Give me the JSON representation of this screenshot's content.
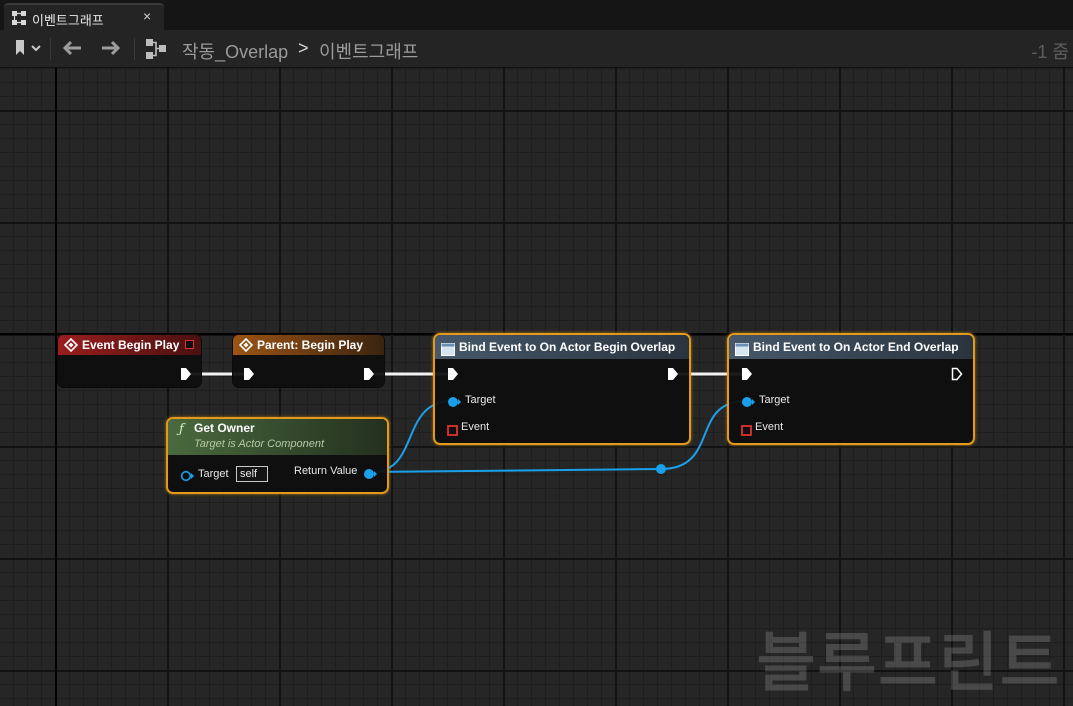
{
  "tab": {
    "title": "이벤트그래프",
    "close": "×"
  },
  "toolbar": {
    "breadcrumb_root": "작동_Overlap",
    "breadcrumb_sep": ">",
    "breadcrumb_current": "이벤트그래프",
    "zoom": "-1 줌"
  },
  "nodes": {
    "event_begin_play": {
      "title": "Event Begin Play"
    },
    "parent_begin_play": {
      "title": "Parent: Begin Play"
    },
    "get_owner": {
      "title": "Get Owner",
      "subtitle": "Target is Actor Component",
      "target_label": "Target",
      "target_value": "self",
      "return_label": "Return Value"
    },
    "bind_begin_overlap": {
      "title": "Bind Event to On Actor Begin Overlap",
      "target_label": "Target",
      "event_label": "Event"
    },
    "bind_end_overlap": {
      "title": "Bind Event to On Actor End Overlap",
      "target_label": "Target",
      "event_label": "Event"
    }
  },
  "watermark": "블루프린트",
  "colors": {
    "event_header": "#8a1a1a",
    "parent_header": "#8a4a18",
    "pure_function_header": "#3d5a34",
    "bind_header": "#3d5060",
    "object_pin": "#1aa0ea",
    "delegate_pin": "#e03030",
    "selection": "#e39a1c"
  }
}
